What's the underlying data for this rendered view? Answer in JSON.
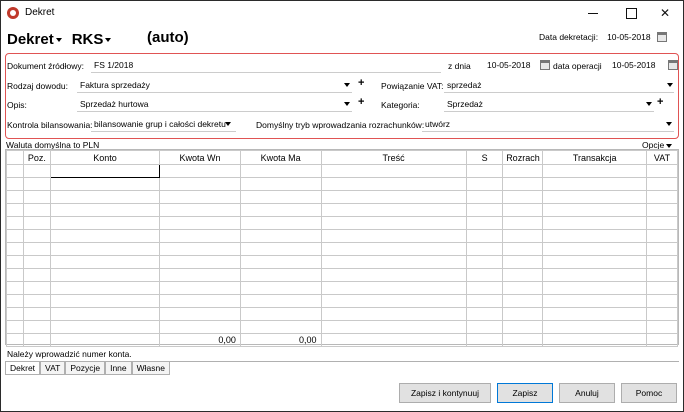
{
  "window": {
    "title": "Dekret"
  },
  "header": {
    "doc_type": "Dekret",
    "register": "RKS",
    "number": "(auto)",
    "date_label": "Data dekretacji:",
    "date_value": "10-05-2018"
  },
  "form": {
    "source_doc_label": "Dokument źródłowy:",
    "source_doc_value": "FS 1/2018",
    "from_date_label": "z dnia",
    "from_date_value": "10-05-2018",
    "operation_date_label": "data operacji",
    "operation_date_value": "10-05-2018",
    "proof_type_label": "Rodzaj dowodu:",
    "proof_type_value": "Faktura sprzedaży",
    "vat_link_label": "Powiązanie VAT:",
    "vat_link_value": "sprzedaż",
    "description_label": "Opis:",
    "description_value": "Sprzedaż hurtowa",
    "category_label": "Kategoria:",
    "category_value": "Sprzedaż",
    "balance_control_label": "Kontrola bilansowania:",
    "balance_control_value": "bilansowanie grup i całości dekretu",
    "default_mode_label": "Domyślny tryb wprowadzania rozrachunków:",
    "default_mode_value": "utwórz"
  },
  "options": {
    "currency_link": "Waluta domyślna to PLN",
    "options_label": "Opcje"
  },
  "table": {
    "columns": [
      "",
      "Poz.",
      "Konto",
      "Kwota Wn",
      "Kwota Ma",
      "Treść",
      "S",
      "Rozrach",
      "Transakcja",
      "VAT"
    ],
    "row_count": 13,
    "totals": {
      "wn": "0,00",
      "ma": "0,00"
    }
  },
  "status_message": "Należy wprowadzić numer konta.",
  "tabs": [
    "Dekret",
    "VAT",
    "Pozycje",
    "Inne",
    "Własne"
  ],
  "buttons": {
    "save_continue": "Zapisz i kontynuuj",
    "save": "Zapisz",
    "cancel": "Anuluj",
    "help": "Pomoc"
  },
  "colors": {
    "highlight_border": "#e05353",
    "primary_button_border": "#0078d7"
  }
}
